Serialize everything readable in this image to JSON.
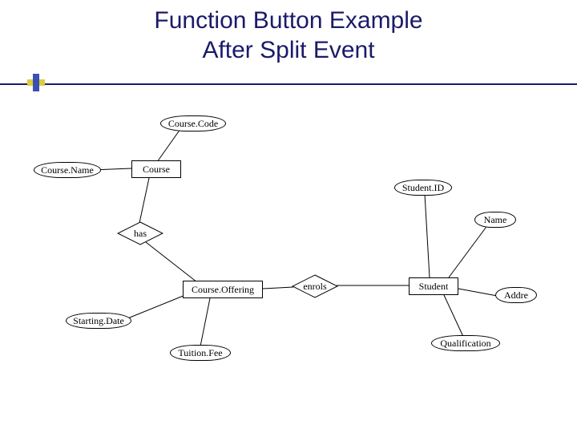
{
  "title_line1": "Function Button Example",
  "title_line2": "After Split Event",
  "er": {
    "entities": {
      "course": "Course",
      "offering": "Course.Offering",
      "student": "Student"
    },
    "relationships": {
      "has": "has",
      "enrols": "enrols"
    },
    "attributes": {
      "course_code": "Course.Code",
      "course_name": "Course.Name",
      "starting_date": "Starting.Date",
      "tuition_fee": "Tuition.Fee",
      "student_id": "Student.ID",
      "student_name": "Name",
      "student_addr": "Addre",
      "student_qual": "Qualification"
    }
  }
}
